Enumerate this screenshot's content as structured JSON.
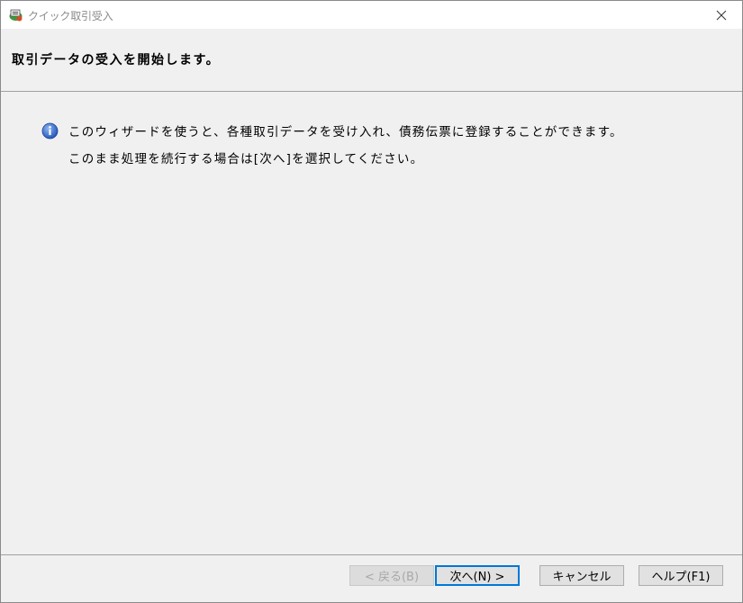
{
  "window": {
    "title": "クイック取引受入"
  },
  "header": {
    "title": "取引データの受入を開始します。"
  },
  "content": {
    "line1": "このウィザードを使うと、各種取引データを受け入れ、債務伝票に登録することができます。",
    "line2": "このまま処理を続行する場合は[次へ]を選択してください。"
  },
  "buttons": {
    "back": "< 戻る(B)",
    "next": "次へ(N) >",
    "cancel": "キャンセル",
    "help": "ヘルプ(F1)"
  },
  "icons": {
    "app": "app-icon",
    "info": "info-icon",
    "close": "close-icon"
  },
  "colors": {
    "accent": "#0078d7",
    "info_icon": "#2a62c9"
  }
}
